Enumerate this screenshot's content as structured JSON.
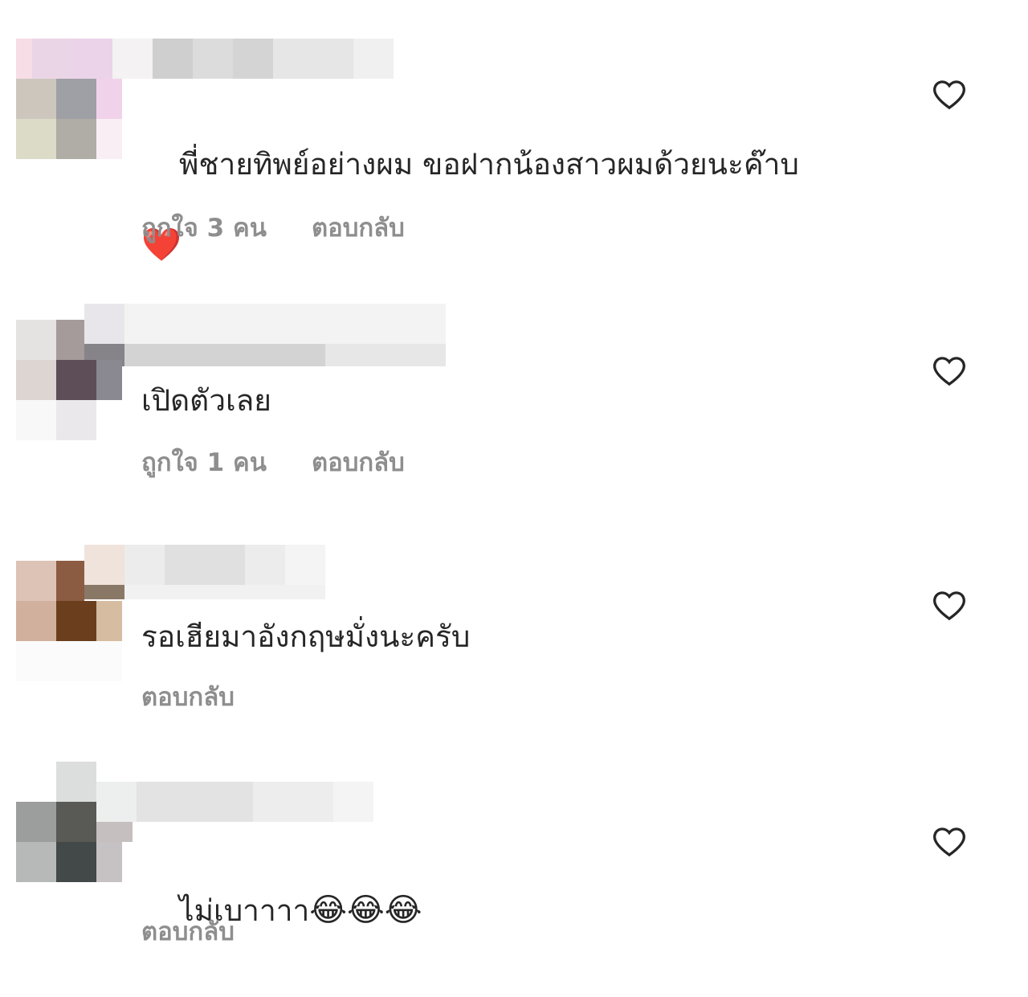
{
  "comments": [
    {
      "text": "พี่ชายทิพย์อย่างผม ขอฝากน้องสาวผมด้วยนะค๊าบ",
      "emoji": "❤️",
      "likes": "ถูกใจ 3 คน",
      "reply": "ตอบกลับ"
    },
    {
      "text": "เปิดตัวเลย",
      "likes": "ถูกใจ 1 คน",
      "reply": "ตอบกลับ"
    },
    {
      "text": "รอเฮียมาอังกฤษมั่งนะครับ",
      "reply": "ตอบกลับ"
    },
    {
      "text": "ไม่เบาาาา",
      "emoji": "😂😂😂",
      "reply": "ตอบกลับ"
    }
  ],
  "icons": {
    "like": "heart-outline-icon"
  },
  "colors": {
    "text": "#262626",
    "meta": "#8e8e8e",
    "icon": "#262626"
  }
}
